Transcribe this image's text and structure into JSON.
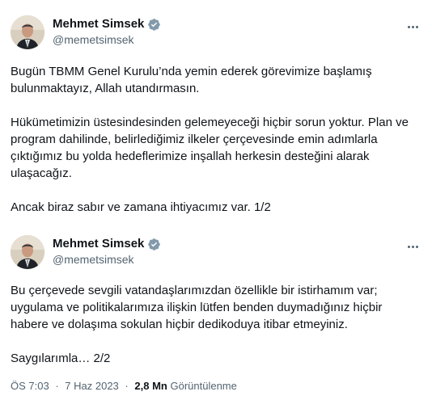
{
  "tweets": [
    {
      "author": {
        "name": "Mehmet Simsek",
        "handle": "@memetsimsek",
        "avatar_icon": "profile-photo",
        "verified_icon": "verified-badge-icon"
      },
      "more_icon": "more-options-icon",
      "paragraphs": [
        "Bugün TBMM Genel Kurulu’nda yemin ederek görevimize başlamış bulunmaktayız, Allah utandırmasın.",
        "Hükümetimizin üstesindesinden  gelemeyeceği hiçbir sorun yoktur. Plan ve program dahilinde, belirlediğimiz ilkeler çerçevesinde emin adımlarla çıktığımız bu yolda hedeflerimize inşallah herkesin desteğini alarak ulaşacağız.",
        "Ancak biraz sabır ve zamana ihtiyacımız var. 1/2"
      ]
    },
    {
      "author": {
        "name": "Mehmet Simsek",
        "handle": "@memetsimsek",
        "avatar_icon": "profile-photo",
        "verified_icon": "verified-badge-icon"
      },
      "more_icon": "more-options-icon",
      "paragraphs": [
        "Bu çerçevede sevgili vatandaşlarımızdan özellikle bir istirhamım var; uygulama ve politikalarımıza ilişkin lütfen benden duymadığınız hiçbir habere ve dolaşıma sokulan hiçbir dedikoduya itibar etmeyiniz.",
        "Saygılarımla… 2/2"
      ],
      "meta": {
        "time": "ÖS 7:03",
        "separator1": "·",
        "date": "7 Haz 2023",
        "separator2": "·",
        "views_count": "2,8 Mn",
        "views_label": "Görüntülenme"
      }
    }
  ],
  "colors": {
    "text": "#0f1419",
    "secondary": "#536471",
    "verified": "#829aab"
  }
}
